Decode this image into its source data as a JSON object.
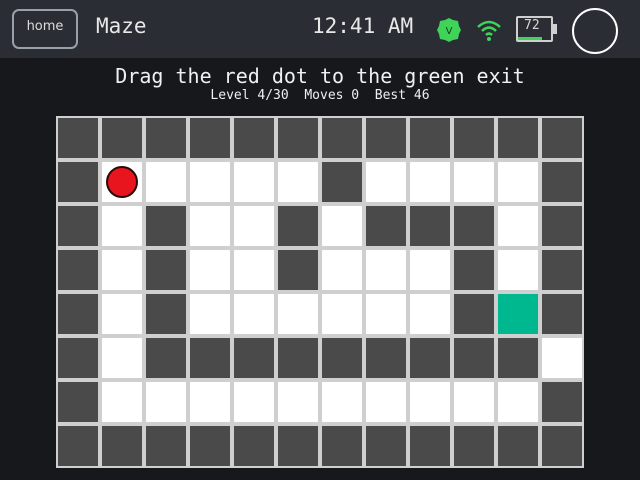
{
  "status_bar": {
    "home_label": "home",
    "app_title": "Maze",
    "time": "12:41 AM",
    "vpn_label": "V",
    "battery_level": "72",
    "battery_percent": 72,
    "colors": {
      "vpn": "#3fd35a",
      "wifi": "#3fd35a",
      "battery_fill": "#3fd35a"
    }
  },
  "game": {
    "instruction": "Drag the red dot to the green exit",
    "stats_text": "Level 4/30  Moves 0  Best 46",
    "level": "4/30",
    "moves": 0,
    "best": 46,
    "maze": {
      "rows": 8,
      "cols": 12,
      "legend": {
        "#": "wall",
        ".": "floor",
        "P": "player",
        "E": "exit"
      },
      "grid": [
        "############",
        "#P....#....#",
        "#.#..#.###.#",
        "#.#..#...#.#",
        "#.#......#E#",
        "#.#########.#",
        "#..........#",
        "############"
      ]
    },
    "colors": {
      "wall": "#4a4a4a",
      "floor": "#ffffff",
      "player": "#e8141e",
      "exit": "#00b890",
      "grid_line": "#cfcfcf"
    }
  }
}
